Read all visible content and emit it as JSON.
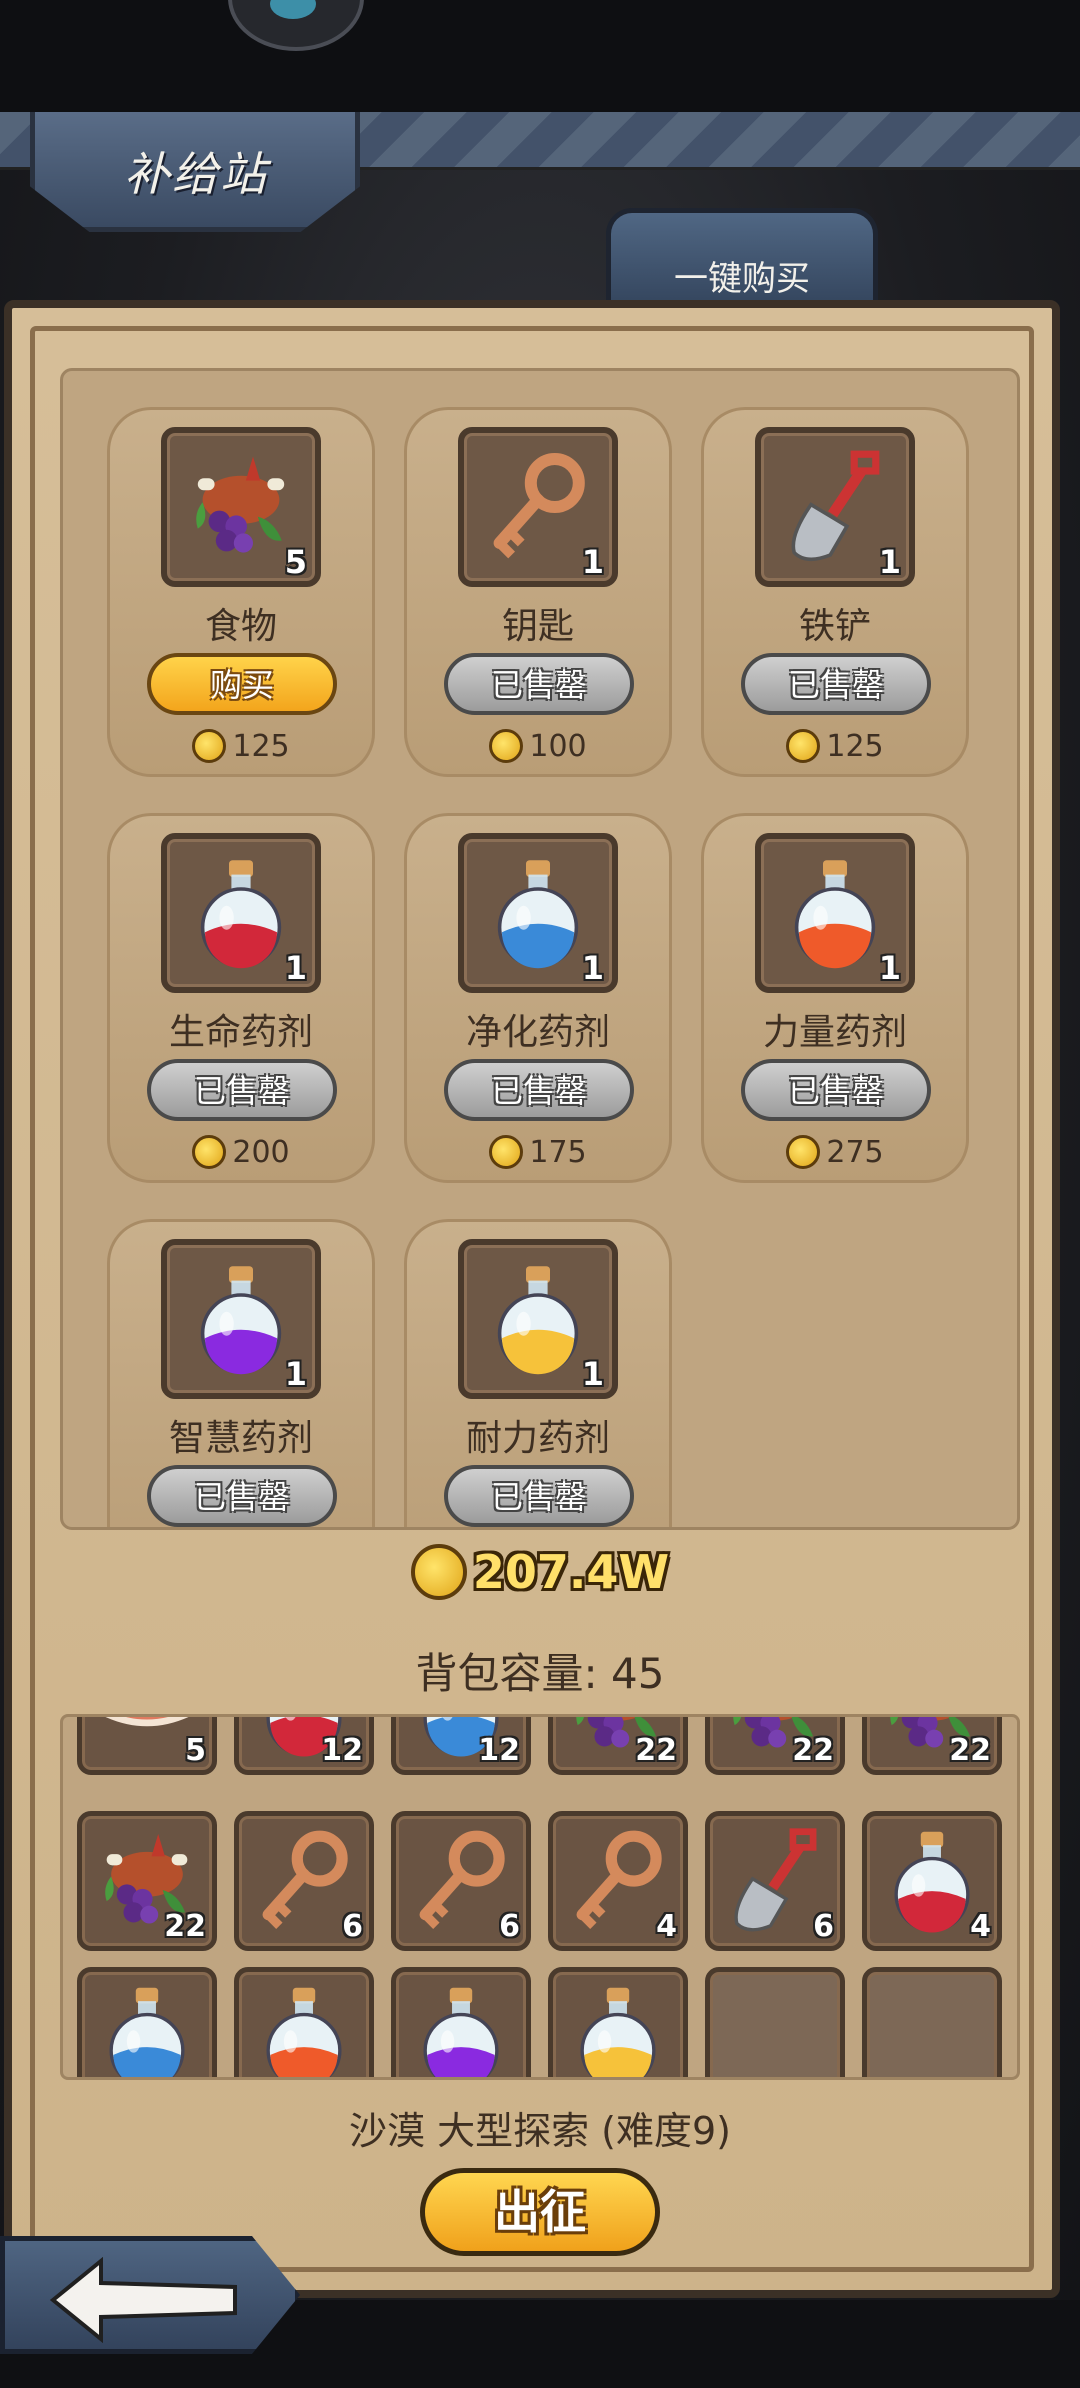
{
  "screen": {
    "title": "补给站",
    "buy_all_label": "一键购买"
  },
  "shop_items": [
    {
      "name": "食物",
      "count": "5",
      "button": "购买",
      "state": "buy",
      "price": "125",
      "icon": "food-icon"
    },
    {
      "name": "钥匙",
      "count": "1",
      "button": "已售罄",
      "state": "sold",
      "price": "100",
      "icon": "key-icon"
    },
    {
      "name": "铁铲",
      "count": "1",
      "button": "已售罄",
      "state": "sold",
      "price": "125",
      "icon": "shovel-icon"
    },
    {
      "name": "生命药剂",
      "count": "1",
      "button": "已售罄",
      "state": "sold",
      "price": "200",
      "icon": "red-potion-icon"
    },
    {
      "name": "净化药剂",
      "count": "1",
      "button": "已售罄",
      "state": "sold",
      "price": "175",
      "icon": "blue-potion-icon"
    },
    {
      "name": "力量药剂",
      "count": "1",
      "button": "已售罄",
      "state": "sold",
      "price": "275",
      "icon": "orange-potion-icon"
    },
    {
      "name": "智慧药剂",
      "count": "1",
      "button": "已售罄",
      "state": "sold",
      "price": "",
      "icon": "purple-potion-icon"
    },
    {
      "name": "耐力药剂",
      "count": "1",
      "button": "已售罄",
      "state": "sold",
      "price": "",
      "icon": "yellow-potion-icon"
    }
  ],
  "gold_total": "207.4W",
  "bag_capacity": "背包容量: 45",
  "inventory": [
    {
      "icon": "meat-icon",
      "count": "5"
    },
    {
      "icon": "red-potion-icon",
      "count": "12"
    },
    {
      "icon": "blue-potion-icon",
      "count": "12"
    },
    {
      "icon": "food-icon",
      "count": "22"
    },
    {
      "icon": "food-icon",
      "count": "22"
    },
    {
      "icon": "food-icon",
      "count": "22"
    },
    {
      "icon": "food-icon",
      "count": "22"
    },
    {
      "icon": "key-icon",
      "count": "6"
    },
    {
      "icon": "key-icon",
      "count": "6"
    },
    {
      "icon": "key-icon",
      "count": "4"
    },
    {
      "icon": "shovel-icon",
      "count": "6"
    },
    {
      "icon": "red-potion-icon",
      "count": "4"
    },
    {
      "icon": "blue-potion-icon",
      "count": ""
    },
    {
      "icon": "orange-potion-icon",
      "count": ""
    },
    {
      "icon": "purple-potion-icon",
      "count": ""
    },
    {
      "icon": "yellow-potion-icon",
      "count": ""
    },
    {
      "icon": "",
      "count": ""
    },
    {
      "icon": "",
      "count": ""
    }
  ],
  "stage_info": "沙漠 大型探索 (难度9)",
  "depart_label": "出征",
  "colors": {
    "gold": "#ffe06a",
    "buy_button": "#f3a51c",
    "sold_button": "#b4b4b4",
    "panel": "#d6be98"
  }
}
